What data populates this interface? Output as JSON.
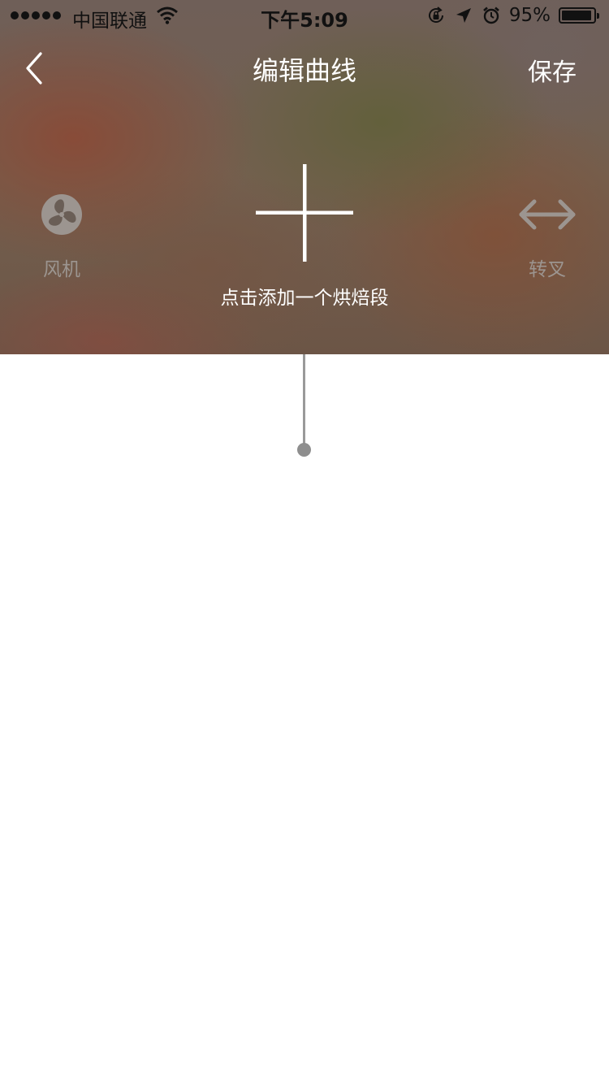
{
  "status_bar": {
    "carrier": "中国联通",
    "time": "下午5:09",
    "battery_percent": "95%",
    "battery_level": 0.95,
    "signal_bars": 5,
    "icons": [
      "signal-dots-icon",
      "wifi-icon",
      "rotation-lock-icon",
      "location-arrow-icon",
      "alarm-icon",
      "battery-icon"
    ]
  },
  "nav": {
    "back_icon": "chevron-left-icon",
    "title": "编辑曲线",
    "save_label": "保存"
  },
  "controls": {
    "fan": {
      "icon": "fan-icon",
      "label": "风机"
    },
    "fork": {
      "icon": "double-arrow-icon",
      "label": "转叉"
    },
    "add": {
      "icon": "plus-icon",
      "hint": "点击添加一个烘焙段"
    }
  },
  "colors": {
    "hero_background": "#6e5a4c",
    "timeline": "#999999",
    "dimmed_label": "#9c9590",
    "text_light": "#ffffff"
  }
}
